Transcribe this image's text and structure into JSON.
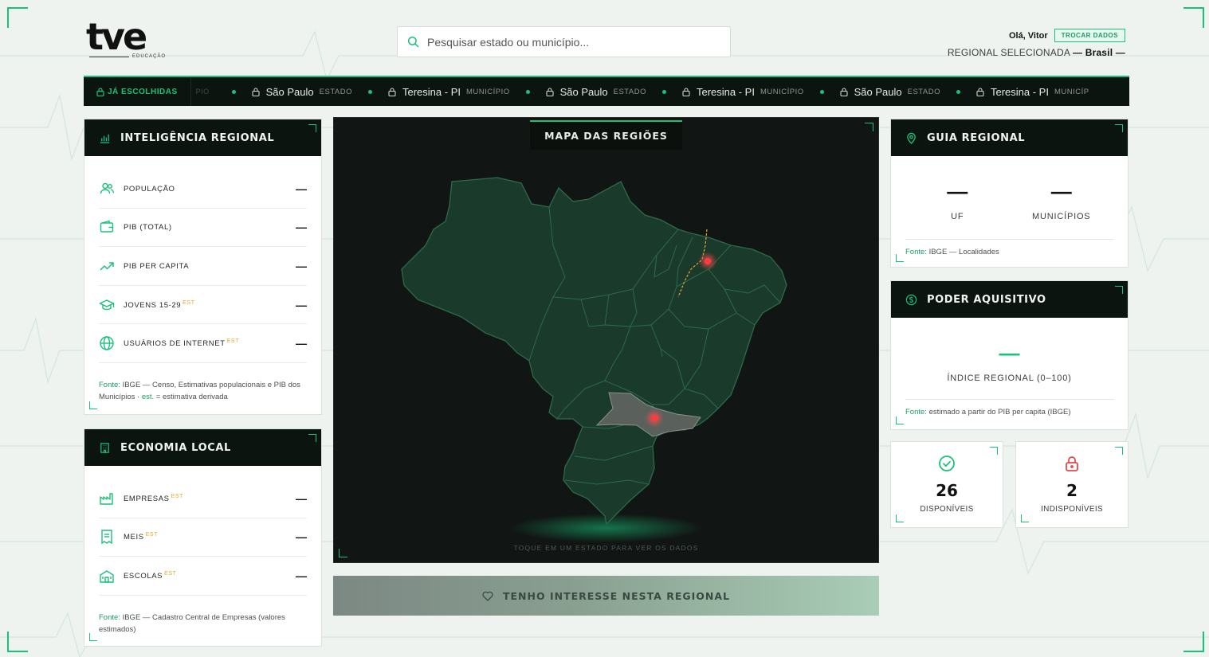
{
  "header": {
    "brand": "tve",
    "brand_sub": "EDUCAÇÃO",
    "search_placeholder": "Pesquisar estado ou município...",
    "greeting": "Olá, Vitor",
    "change_button": "TROCAR DADOS",
    "region_label": "REGIONAL SELECIONADA",
    "region_value": "— Brasil —"
  },
  "ticker": {
    "head": "JÁ ESCOLHIDAS",
    "fragment": "PIO",
    "items": [
      {
        "name": "São Paulo",
        "type": "ESTADO"
      },
      {
        "name": "Teresina - PI",
        "type": "MUNICÍPIO"
      },
      {
        "name": "São Paulo",
        "type": "ESTADO"
      },
      {
        "name": "Teresina - PI",
        "type": "MUNICÍPIO"
      },
      {
        "name": "São Paulo",
        "type": "ESTADO"
      },
      {
        "name": "Teresina - PI",
        "type": "MUNICÍP"
      }
    ]
  },
  "intel": {
    "title": "INTELIGÊNCIA REGIONAL",
    "metrics": [
      {
        "label": "POPULAÇÃO",
        "est": "",
        "value": "—",
        "icon": "users-icon"
      },
      {
        "label": "PIB (TOTAL)",
        "est": "",
        "value": "—",
        "icon": "wallet-icon"
      },
      {
        "label": "PIB PER CAPITA",
        "est": "",
        "value": "—",
        "icon": "trend-up-icon"
      },
      {
        "label": "JOVENS 15-29",
        "est": "EST",
        "value": "—",
        "icon": "graduation-cap-icon"
      },
      {
        "label": "USUÁRIOS DE INTERNET",
        "est": "EST",
        "value": "—",
        "icon": "globe-icon"
      }
    ],
    "note_src": "Fonte:",
    "note_text": " IBGE — Censo, Estimativas populacionais e PIB dos Municípios · ",
    "note_est": "est.",
    "note_tail": " = estimativa derivada"
  },
  "economy": {
    "title": "ECONOMIA LOCAL",
    "metrics": [
      {
        "label": "EMPRESAS",
        "est": "EST",
        "value": "—",
        "icon": "factory-icon"
      },
      {
        "label": "MEIS",
        "est": "EST",
        "value": "—",
        "icon": "receipt-icon"
      },
      {
        "label": "ESCOLAS",
        "est": "EST",
        "value": "—",
        "icon": "school-icon"
      }
    ],
    "note_src": "Fonte:",
    "note_text": " IBGE — Cadastro Central de Empresas (valores estimados)"
  },
  "map": {
    "title": "MAPA DAS REGIÕES",
    "hint": "TOQUE EM UM ESTADO PARA VER OS DADOS",
    "accent": "#19c27a",
    "selected_color": "#5a615d",
    "marker_color": "#ff3b3b"
  },
  "interest_button": "TENHO INTERESSE NESTA REGIONAL",
  "guide": {
    "title": "GUIA REGIONAL",
    "uf_value": "—",
    "uf_label": "UF",
    "mun_value": "—",
    "mun_label": "MUNICÍPIOS",
    "note_src": "Fonte:",
    "note_text": " IBGE — Localidades"
  },
  "power": {
    "title": "PODER AQUISITIVO",
    "value": "—",
    "label": "ÍNDICE REGIONAL (0–100)",
    "note_src": "Fonte:",
    "note_text": " estimado a partir do PIB per capita (IBGE)"
  },
  "available": {
    "value": "26",
    "label": "DISPONÍVEIS"
  },
  "unavailable": {
    "value": "2",
    "label": "INDISPONÍVEIS"
  },
  "colors": {
    "accent": "#19c27a",
    "dark": "#0c1410",
    "warn": "#e9a826",
    "danger": "#e5484d"
  }
}
